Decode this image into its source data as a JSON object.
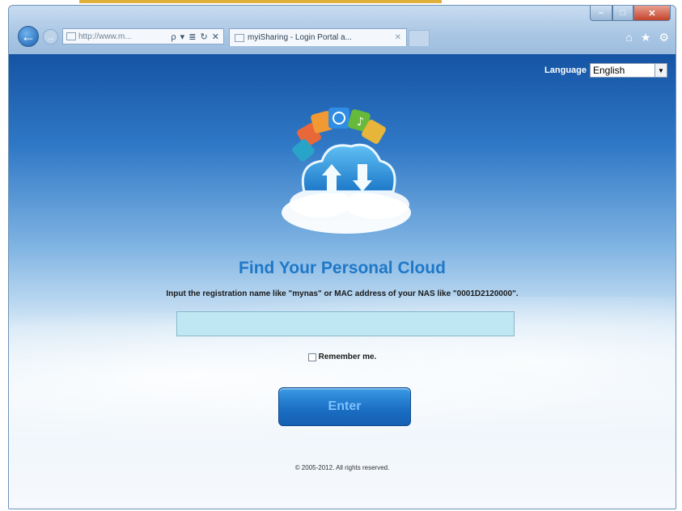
{
  "browser": {
    "address_url": "http://www.m...",
    "address_controls": "ρ ▾ ≣ ↻ ✕",
    "tab_title": "myiSharing - Login Portal a...",
    "tab_close": "✕",
    "back_glyph": "←",
    "forward_glyph": "→",
    "window_min": "–",
    "window_max": "□",
    "window_close": "✕",
    "tools": [
      "⌂",
      "★",
      "⚙"
    ]
  },
  "language": {
    "label": "Language",
    "selected": "English",
    "arrow": "▼"
  },
  "main": {
    "heading": "Find Your Personal Cloud",
    "instruction": "Input the registration name like \"mynas\" or MAC address of your NAS like \"0001D2120000\".",
    "input_value": "",
    "remember_label": "Remember me.",
    "enter_label": "Enter",
    "footer": "© 2005-2012. All rights reserved."
  },
  "colors": {
    "heading": "#1e78c8",
    "input_bg": "#bfe7f3",
    "button": "#1a6dc2",
    "button_text": "#7cc2ff"
  },
  "icons": [
    "back-arrow-icon",
    "forward-arrow-icon",
    "page-icon",
    "home-icon",
    "favorites-star-icon",
    "gear-icon",
    "cloud-logo-icon",
    "dropdown-arrow-icon"
  ]
}
